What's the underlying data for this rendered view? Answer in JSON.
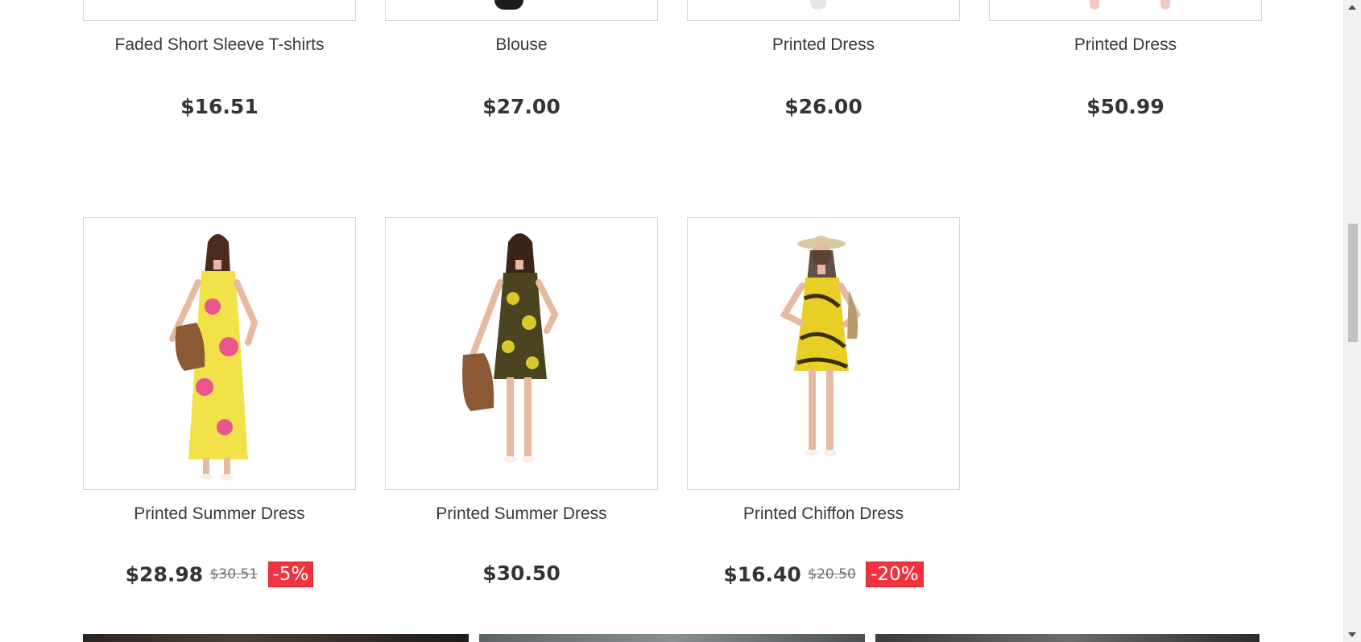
{
  "products_row1": [
    {
      "name": "Faded Short Sleeve T-shirts",
      "price": "$16.51"
    },
    {
      "name": "Blouse",
      "price": "$27.00"
    },
    {
      "name": "Printed Dress",
      "price": "$26.00"
    },
    {
      "name": "Printed Dress",
      "price": "$50.99"
    }
  ],
  "products_row2": [
    {
      "name": "Printed Summer Dress",
      "price": "$28.98",
      "old_price": "$30.51",
      "discount": "-5%",
      "dress_color": "#f2e24a",
      "pattern_color": "#e8558f"
    },
    {
      "name": "Printed Summer Dress",
      "price": "$30.50",
      "dress_color": "#4b4420",
      "pattern_color": "#d9c92a"
    },
    {
      "name": "Printed Chiffon Dress",
      "price": "$16.40",
      "old_price": "$20.50",
      "discount": "-20%",
      "dress_color": "#e8cf25",
      "pattern_color": "#3b2f12"
    }
  ],
  "colors": {
    "discount_badge": "#f13340",
    "border": "#d6d4d4",
    "text": "#333333"
  },
  "icons": {
    "scroll_up": "scroll-up-arrow-icon",
    "scroll_down": "scroll-down-arrow-icon"
  }
}
